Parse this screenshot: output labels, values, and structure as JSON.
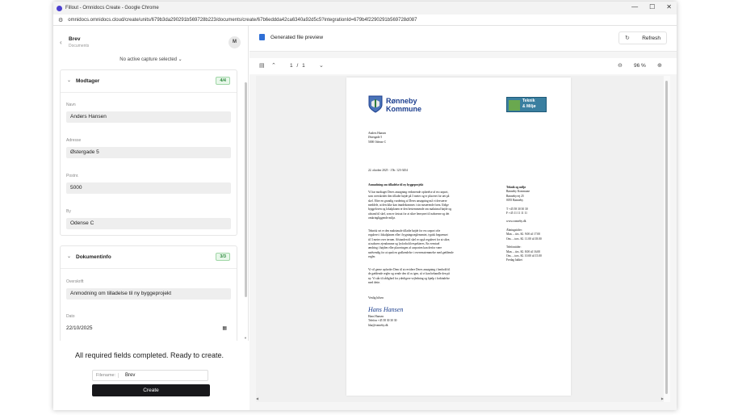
{
  "browser": {
    "title": "Fillout - Omnidocs Create - Google Chrome",
    "url": "omnidocs.omnidocs.cloud/create/units/679b3da290291b569728b223/documents/create/67b6eddda42ca6340a92d5c5?integrationId=679b4f2290291b569728d087",
    "controls": [
      "—",
      "☐",
      "✕"
    ]
  },
  "left": {
    "title": "Brev",
    "subtitle": "Documents",
    "avatar": "M",
    "capture": "No active capture selected",
    "sections": [
      {
        "title": "Modtager",
        "badge": "4/4",
        "fields": [
          {
            "label": "Navn",
            "value": "Anders Hansen"
          },
          {
            "label": "Adresse",
            "value": "Østergade 5"
          },
          {
            "label": "Postnr.",
            "value": "5000"
          },
          {
            "label": "By",
            "value": "Odense C"
          }
        ]
      },
      {
        "title": "Dokumentinfo",
        "badge": "3/3",
        "fields": [
          {
            "label": "Overskrift",
            "value": "Anmodning om tilladelse til ny byggeprojekt"
          },
          {
            "label": "Dato",
            "value": "22/10/2025"
          }
        ]
      }
    ],
    "ready_text": "All required fields completed. Ready to create.",
    "filename_label": "Filename:",
    "filename_value": "Brev",
    "create_label": "Create"
  },
  "right": {
    "preview_label": "Generated file preview",
    "refresh_label": "Refresh",
    "page_current": "1",
    "page_sep": "/",
    "page_total": "1",
    "zoom": "96 %",
    "doc": {
      "muni_line1": "Rønneby",
      "muni_line2": "Kommune",
      "tm_line1": "Teknik",
      "tm_line2": "& Miljø",
      "recipient": [
        "Anders Hansen",
        "Østergade 5",
        "5000 Odense C"
      ],
      "date_ref": "22. oktober 2025 - J.Nr. 123-3454",
      "heading": "Anmodning om tilladelse til ny byggeprojekt",
      "para1": [
        "Vi har modtaget Deres ansøgning vedrørende opførelse af en carport,",
        "som overskrider den tilladte højde på 3 meter og er placeret for tæt på",
        "skel. Efter en grundig vurdering af Deres ansøgning må vi desværre",
        "meddele, at den ikke kan imødekommes i sin nuværende form. Ifølge",
        "byggeloven og lokalplanen er den bestemmende om maksimal højde og",
        "afstand til skel, som er fastsat for at sikre hensynet til naboerne og det",
        "omkringliggende miljø."
      ],
      "para2": [
        "Teknisk set er den maksimale tilladte højde for en carport ofte",
        "reguleret i lokalplanen eller i bygningsreglementet, typisk begrænset",
        "til 3 meter over terræn. Afstanden til skel er også reguleret for at sikre,",
        "at naboers ejendomme og lysforhold respekteres. En eventuel",
        "ændring i højden eller placeringen af carporten kan derfor være",
        "nødvendig for at opnå en godkendelse i overensstemmelse med gældende",
        "regler."
      ],
      "para3": [
        "Vi vil gerne opfordre Dem til at revidere Deres ansøgning i henhold til",
        "de gældende regler og sende den til os igen, så vi kan behandle den på",
        "ny. Vi står til rådighed for yderligere vejledning og hjælp i forbindelse",
        "med dette."
      ],
      "closing": "Venlig hilsen",
      "signature": "Hans Hansen",
      "sender": [
        "Hans Hansen",
        "Telefon +45 58 30 30 30",
        "hha@ronneby.dk"
      ],
      "sidebar": [
        {
          "bold": true,
          "text": "Teknik og miljø"
        },
        {
          "bold": false,
          "text": "Rønneby Kommune"
        },
        {
          "bold": false,
          "text": "Rønnebyvej 25"
        },
        {
          "bold": false,
          "text": "0055 Rønneby"
        },
        {
          "bold": false,
          "text": ""
        },
        {
          "bold": false,
          "text": "T +45 58 30 30 30"
        },
        {
          "bold": false,
          "text": "F +45 11 11 11 11"
        },
        {
          "bold": false,
          "text": ""
        },
        {
          "bold": false,
          "text": "www.ronneby.dk"
        },
        {
          "bold": false,
          "text": ""
        },
        {
          "bold": false,
          "text": "Åbningstider:"
        },
        {
          "bold": false,
          "text": "Man. – tirs. Kl. 9.00 til 17.00"
        },
        {
          "bold": false,
          "text": "Ons. – tors. Kl. 11.00 til 18.00"
        },
        {
          "bold": false,
          "text": ""
        },
        {
          "bold": false,
          "text": "Telefontider:"
        },
        {
          "bold": false,
          "text": "Man. – tirs. Kl. 8.00 til 16.00"
        },
        {
          "bold": false,
          "text": "Ons. – tors. Kl. 10.00 til 15.00"
        },
        {
          "bold": false,
          "text": "Fredag lukket"
        }
      ]
    }
  },
  "colors": {
    "accent": "#18181b",
    "badge_green": "#2e8b3e",
    "brand_blue": "#1c3f8f"
  }
}
